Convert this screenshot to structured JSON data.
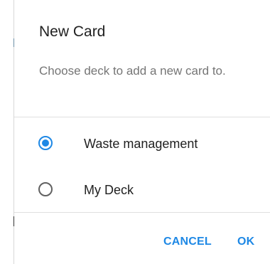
{
  "dialog": {
    "title": "New Card",
    "subtitle": "Choose deck to add a new card to.",
    "options": [
      {
        "label": "Waste management",
        "selected": true
      },
      {
        "label": "My Deck",
        "selected": false
      }
    ],
    "buttons": {
      "cancel_label": "CANCEL",
      "ok_label": "OK"
    }
  },
  "colors": {
    "accent": "#1e88e5",
    "title_text": "#212121",
    "secondary_text": "#757575",
    "divider": "#e0e0e0"
  }
}
